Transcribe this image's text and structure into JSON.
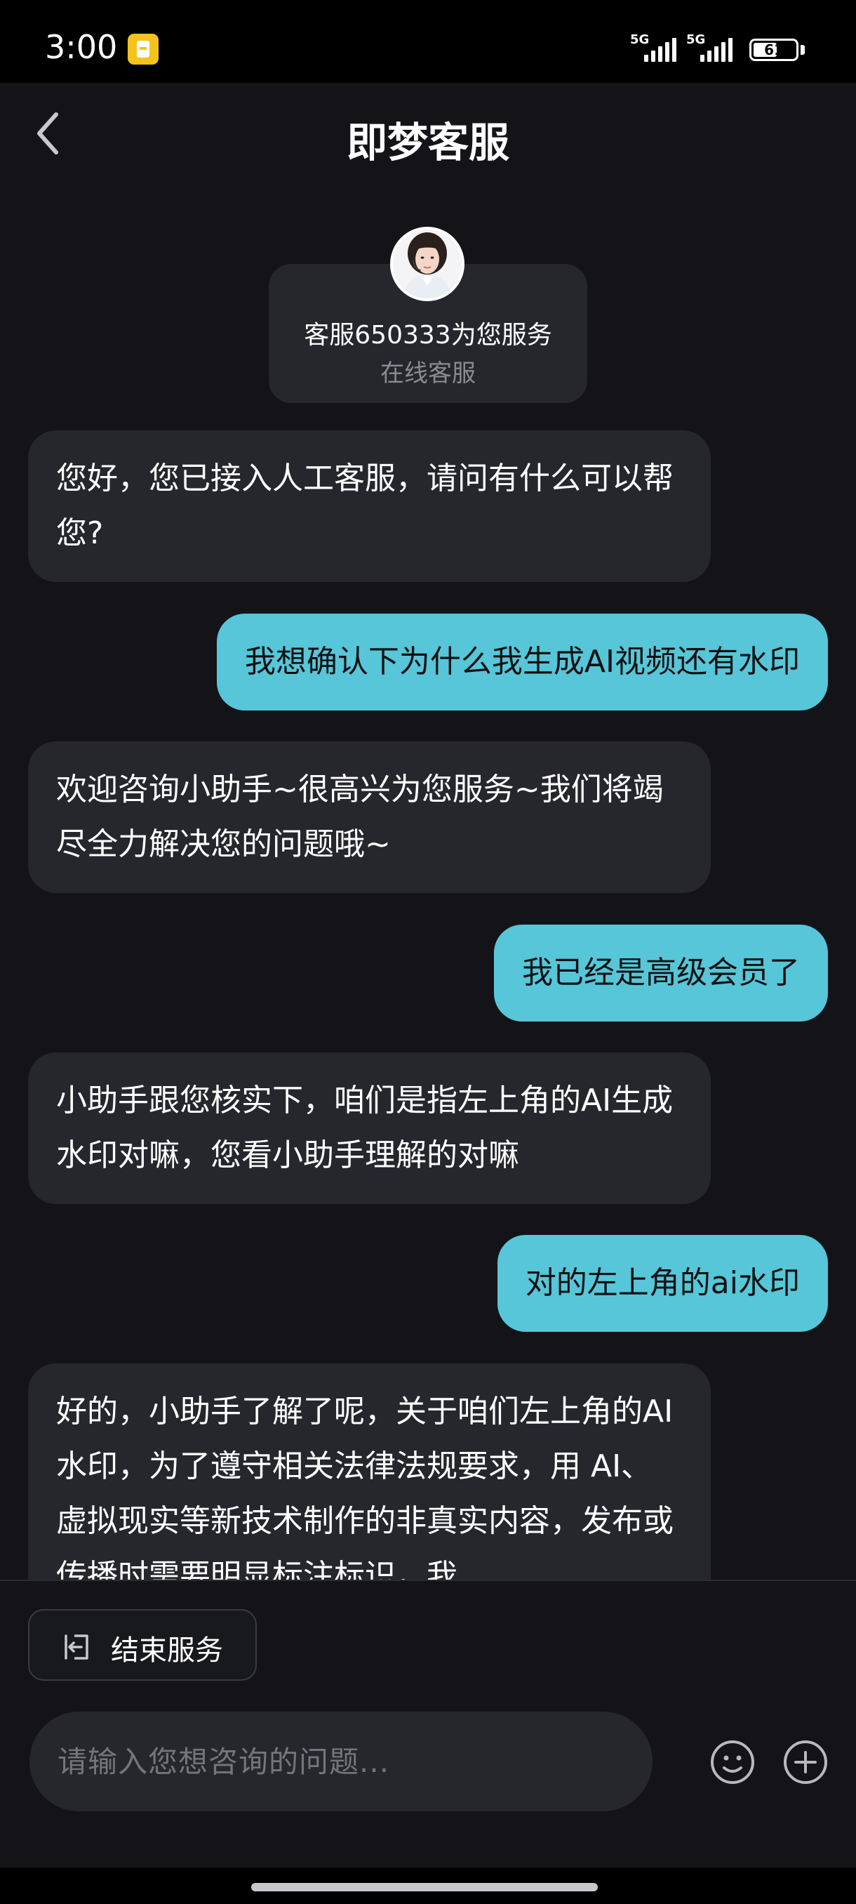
{
  "status_bar": {
    "time": "3:00",
    "network_1": "5G",
    "network_2": "5G",
    "battery": "61"
  },
  "header": {
    "title": "即梦客服"
  },
  "agent": {
    "name": "客服650333为您服务",
    "subtitle": "在线客服"
  },
  "messages": [
    {
      "side": "in",
      "text": "您好，您已接入人工客服，请问有什么可以帮您?"
    },
    {
      "side": "out",
      "text": "我想确认下为什么我生成AI视频还有水印"
    },
    {
      "side": "in",
      "text": "欢迎咨询小助手~很高兴为您服务~我们将竭尽全力解决您的问题哦~"
    },
    {
      "side": "out",
      "text": "我已经是高级会员了"
    },
    {
      "side": "in",
      "text": "小助手跟您核实下，咱们是指左上角的AI生成水印对嘛，您看小助手理解的对嘛"
    },
    {
      "side": "out",
      "text": "对的左上角的ai水印"
    },
    {
      "side": "in",
      "text": "好的，小助手了解了呢，关于咱们左上角的AI水印，为了遵守相关法律法规要求，用 AI、虚拟现实等新技术制作的非真实内容，发布或传播时需要明显标注标识，我"
    }
  ],
  "footer": {
    "end_service_label": "结束服务",
    "input_placeholder": "请输入您想咨询的问题..."
  },
  "colors": {
    "background": "#141418",
    "bubble_in": "#26272d",
    "bubble_out": "#57c6d8",
    "muted_text": "#8a8b90"
  }
}
